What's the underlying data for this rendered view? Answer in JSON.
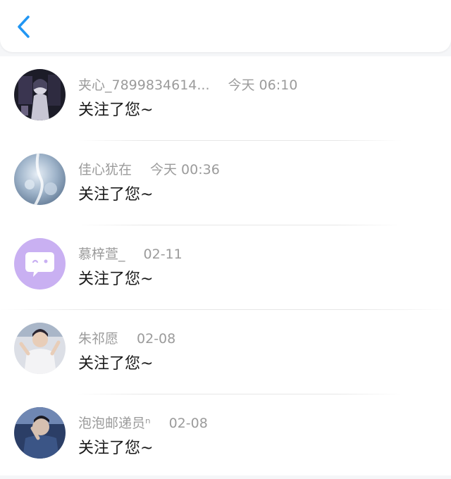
{
  "colors": {
    "accent": "#2196f3",
    "name_text": "#9b9b9b",
    "message_text": "#1a1a1a",
    "badge_purple": "#c9b0f2"
  },
  "header": {
    "back_icon": "chevron-left-icon"
  },
  "items": [
    {
      "name": "夹心_7899834614...",
      "time": "今天 06:10",
      "message": "关注了您~"
    },
    {
      "name": "佳心犹在",
      "time": "今天 00:36",
      "message": "关注了您~"
    },
    {
      "name": "慕梓萱_",
      "time": "02-11",
      "message": "关注了您~"
    },
    {
      "name": "朱祁愿",
      "time": "02-08",
      "message": "关注了您~"
    },
    {
      "name": "泡泡邮递员ⁿ",
      "time": "02-08",
      "message": "关注了您~"
    }
  ]
}
